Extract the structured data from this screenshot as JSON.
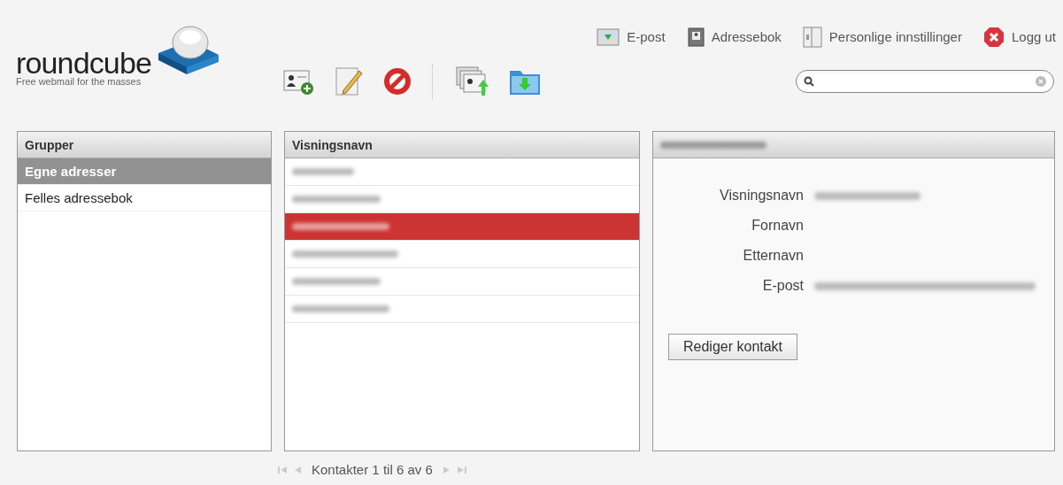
{
  "logo": {
    "name": "roundcube",
    "tagline": "Free webmail for the masses"
  },
  "nav": [
    {
      "kind": "mail",
      "label": "E-post"
    },
    {
      "kind": "addressbook",
      "label": "Adressebok"
    },
    {
      "kind": "settings",
      "label": "Personlige innstillinger"
    },
    {
      "kind": "logout",
      "label": "Logg ut"
    }
  ],
  "toolbar": [
    {
      "kind": "add"
    },
    {
      "kind": "edit"
    },
    {
      "kind": "delete"
    },
    {
      "kind": "import"
    },
    {
      "kind": "export"
    }
  ],
  "groups": {
    "header": "Grupper",
    "items": [
      {
        "label": "Egne adresser",
        "selected": true
      },
      {
        "label": "Felles adressebok",
        "selected": false
      }
    ]
  },
  "contacts": {
    "header": "Visningsnavn",
    "rows": [
      {
        "selected": false,
        "redacted": true
      },
      {
        "selected": false,
        "redacted": true
      },
      {
        "selected": true,
        "redacted": true
      },
      {
        "selected": false,
        "redacted": true
      },
      {
        "selected": false,
        "redacted": true
      },
      {
        "selected": false,
        "redacted": true
      }
    ]
  },
  "details": {
    "title_redacted": true,
    "fields": [
      {
        "label": "Visningsnavn",
        "redacted": true
      },
      {
        "label": "Fornavn",
        "redacted": false
      },
      {
        "label": "Etternavn",
        "redacted": false
      },
      {
        "label": "E-post",
        "redacted": true
      }
    ],
    "button": "Rediger kontakt"
  },
  "pager": {
    "text": "Kontakter 1 til 6 av 6"
  }
}
